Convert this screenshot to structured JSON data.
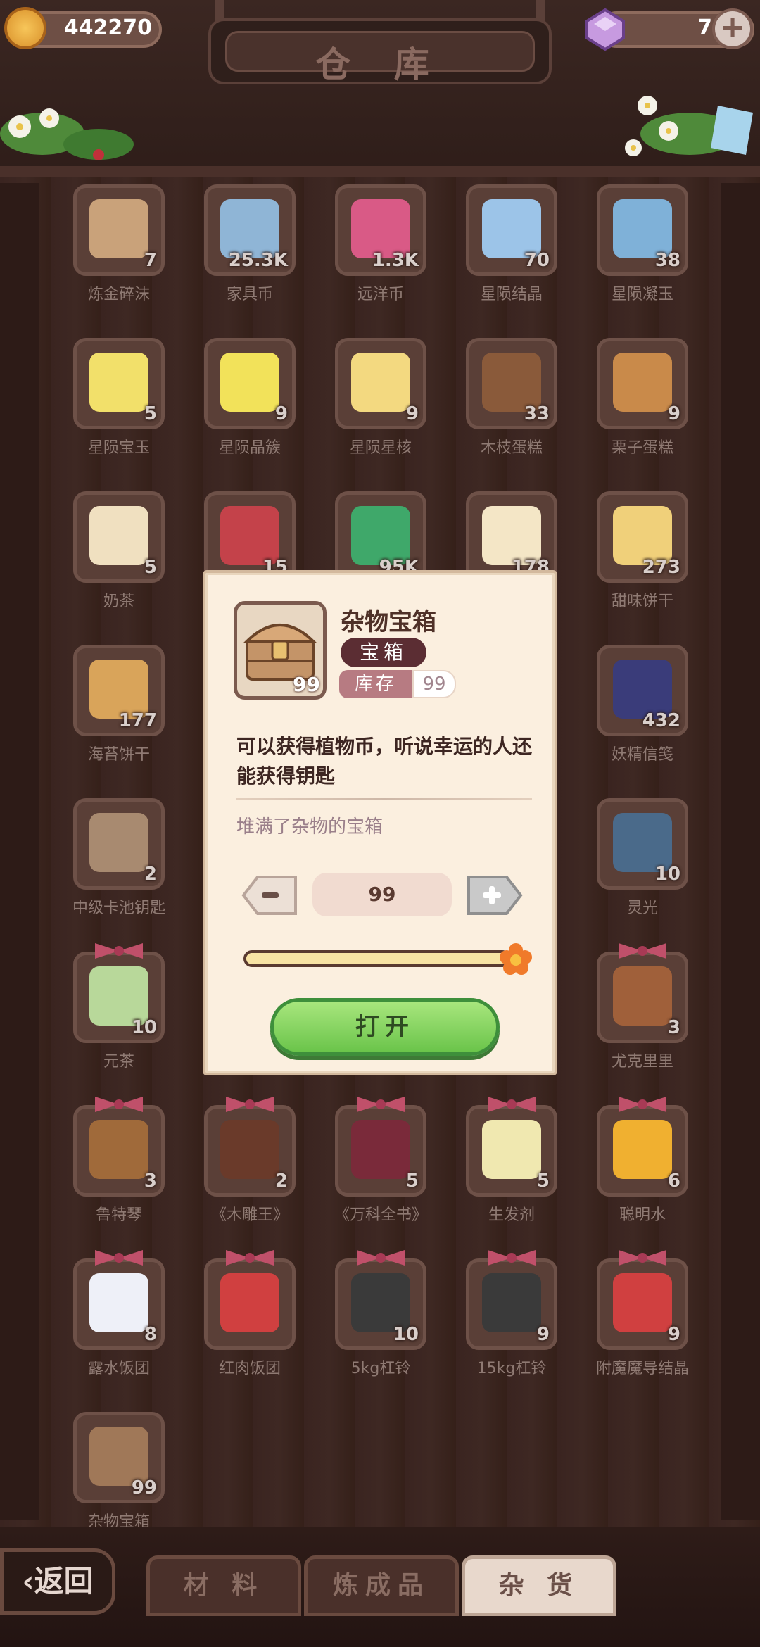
{
  "header": {
    "title": "仓 库",
    "coins": "442270",
    "gems": "7"
  },
  "items": [
    {
      "name": "炼金碎沫",
      "count": "7",
      "color": "#c9a27a",
      "icon": "rock-icon"
    },
    {
      "name": "家具币",
      "count": "25.3K",
      "color": "#8fb5d6",
      "icon": "furniture-coin-icon"
    },
    {
      "name": "远洋币",
      "count": "1.3K",
      "color": "#d95a86",
      "icon": "ocean-coin-icon"
    },
    {
      "name": "星陨结晶",
      "count": "70",
      "color": "#9cc4e8",
      "icon": "crystal-icon"
    },
    {
      "name": "星陨凝玉",
      "count": "38",
      "color": "#7fb1d8",
      "icon": "star-jade-icon"
    },
    {
      "name": "星陨宝玉",
      "count": "5",
      "color": "#f2e06a",
      "icon": "yellow-gem-icon"
    },
    {
      "name": "星陨晶簇",
      "count": "9",
      "color": "#f2e25a",
      "icon": "star-cluster-icon"
    },
    {
      "name": "星陨星核",
      "count": "9",
      "color": "#f3d980",
      "icon": "star-core-icon"
    },
    {
      "name": "木枝蛋糕",
      "count": "33",
      "color": "#8a5a3a",
      "icon": "log-cake-icon"
    },
    {
      "name": "栗子蛋糕",
      "count": "9",
      "color": "#c98a4a",
      "icon": "chestnut-cake-icon"
    },
    {
      "name": "奶茶",
      "count": "5",
      "color": "#f0e0c0",
      "icon": "milk-tea-icon"
    },
    {
      "name": "",
      "count": "15",
      "color": "#c4424a",
      "icon": "berry-cake-icon"
    },
    {
      "name": "",
      "count": "95K",
      "color": "#3fa86a",
      "icon": "plant-coin-icon"
    },
    {
      "name": "",
      "count": "178",
      "color": "#f4e6c6",
      "icon": "marshmallow-icon"
    },
    {
      "name": "甜味饼干",
      "count": "273",
      "color": "#f0d07a",
      "icon": "cracker-icon"
    },
    {
      "name": "海苔饼干",
      "count": "177",
      "color": "#d9a45a",
      "icon": "seaweed-cracker-icon"
    },
    {
      "name": "妖精信笺",
      "count": "432",
      "color": "#3a3c7a",
      "icon": "fairy-letter-icon"
    },
    {
      "name": "中级卡池钥匙",
      "count": "2",
      "color": "#a88a70",
      "icon": "key-icon"
    },
    {
      "name": "灵光",
      "count": "10",
      "color": "#4a6a8a",
      "icon": "spirit-light-icon"
    },
    {
      "name": "元茶",
      "count": "10",
      "color": "#b8d89a",
      "icon": "tea-icon"
    },
    {
      "name": "尤克里里",
      "count": "3",
      "color": "#a0603a",
      "icon": "ukulele-icon"
    },
    {
      "name": "鲁特琴",
      "count": "3",
      "color": "#a06a3a",
      "icon": "lute-icon"
    },
    {
      "name": "《木雕王》",
      "count": "2",
      "color": "#6a3a2a",
      "icon": "book-brown-icon"
    },
    {
      "name": "《万科全书》",
      "count": "5",
      "color": "#7a2a3a",
      "icon": "book-red-icon"
    },
    {
      "name": "生发剂",
      "count": "5",
      "color": "#f0e8b0",
      "icon": "bottle-icon"
    },
    {
      "name": "聪明水",
      "count": "6",
      "color": "#f0b030",
      "icon": "smart-water-icon"
    },
    {
      "name": "露水饭团",
      "count": "8",
      "color": "#eef0f8",
      "icon": "rice-ball-icon"
    },
    {
      "name": "红肉饭团",
      "count": "",
      "color": "#d04040",
      "icon": "meat-rice-ball-icon"
    },
    {
      "name": "5kg杠铃",
      "count": "10",
      "color": "#3a3a3a",
      "icon": "dumbbell-icon"
    },
    {
      "name": "15kg杠铃",
      "count": "9",
      "color": "#3a3a3a",
      "icon": "dumbbell-large-icon"
    },
    {
      "name": "附魔魔导结晶",
      "count": "9",
      "color": "#d04040",
      "icon": "magic-crystal-icon"
    },
    {
      "name": "杂物宝箱",
      "count": "99",
      "color": "#a07858",
      "icon": "chest-icon"
    }
  ],
  "popup": {
    "title": "杂物宝箱",
    "type": "宝箱",
    "stock_label": "库存",
    "stock_value": "99",
    "thumb_count": "99",
    "description": "可以获得植物币，听说幸运的人还能获得钥匙",
    "flavor": "堆满了杂物的宝箱",
    "quantity": "99",
    "slider_fraction": 1.0,
    "open_label": "打开"
  },
  "footer": {
    "back_label": "返回",
    "tabs": [
      "材 料",
      "炼成品",
      "杂 货"
    ],
    "active_tab": 2
  }
}
